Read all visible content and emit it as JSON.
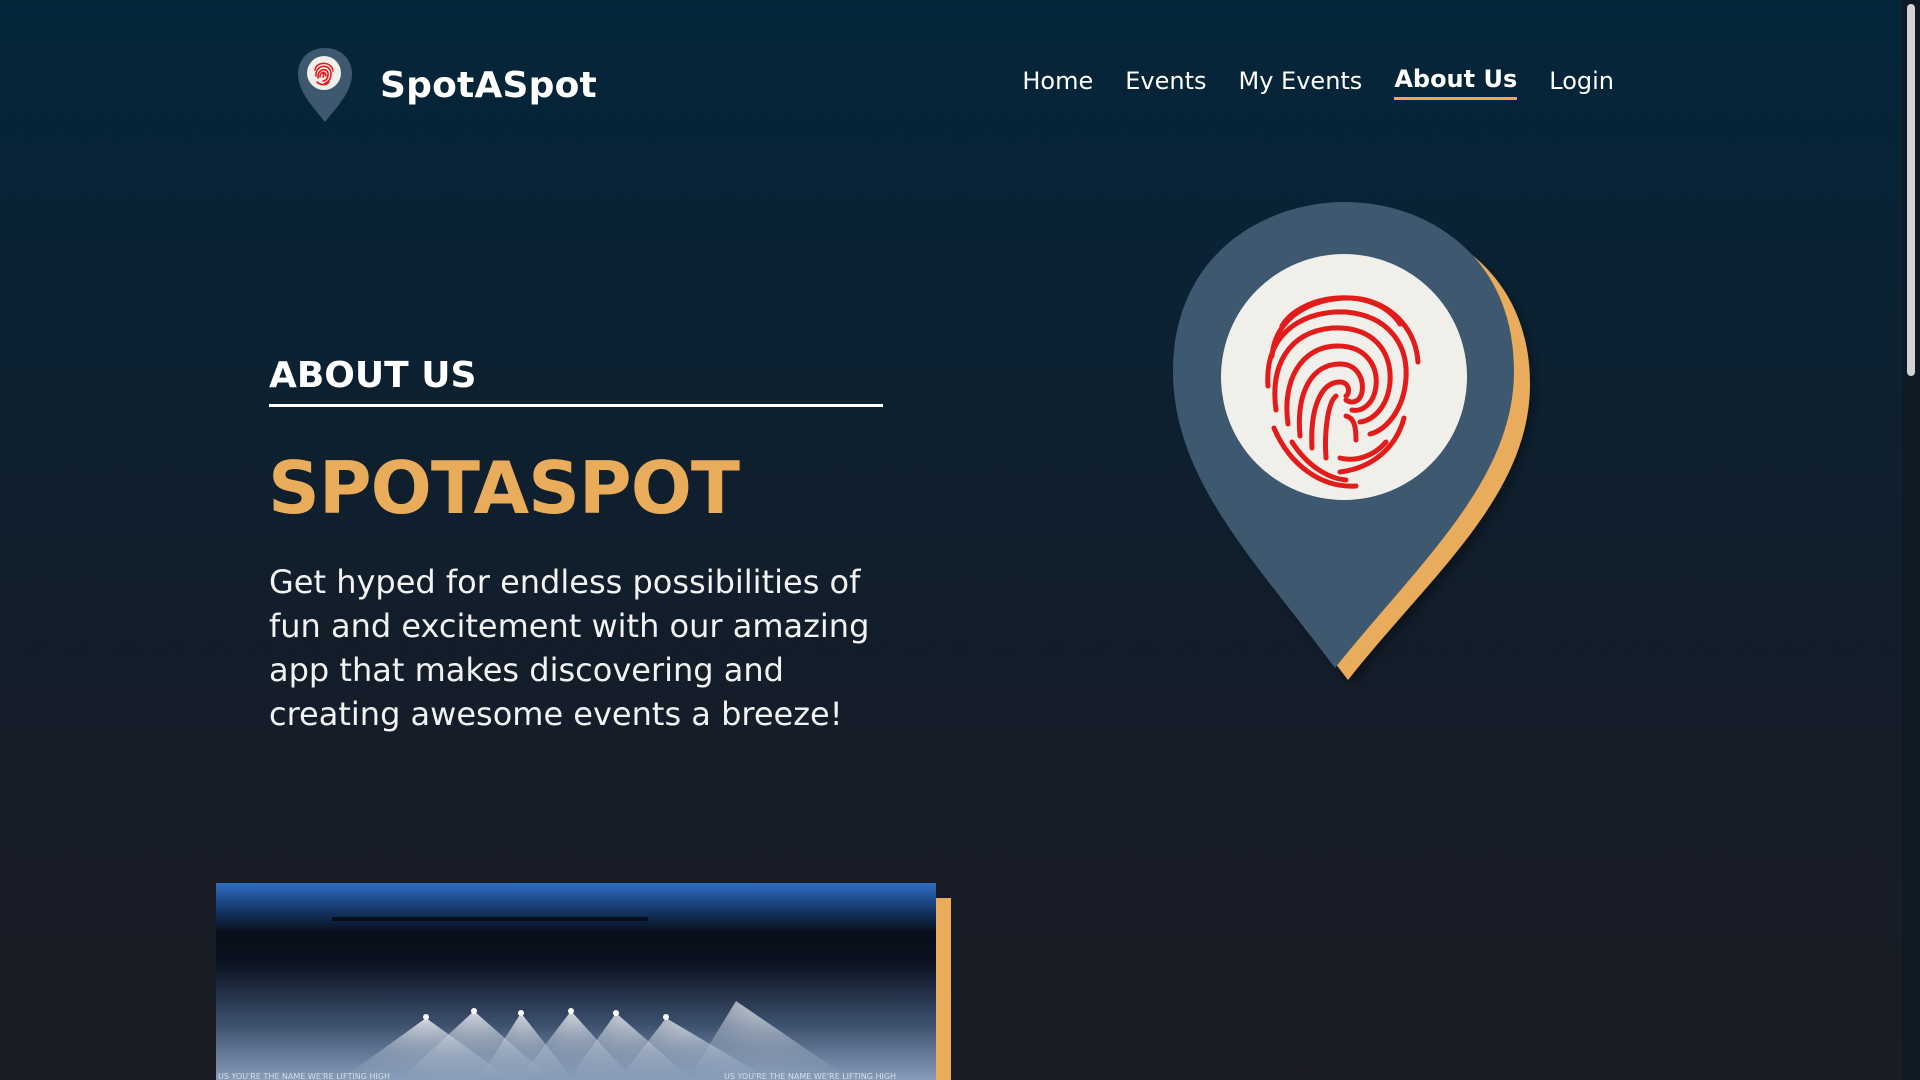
{
  "navbar": {
    "brand_name": "SpotASpot",
    "logo_icon": "map-pin-fingerprint-icon",
    "links": [
      {
        "label": "Home",
        "active": false
      },
      {
        "label": "Events",
        "active": false
      },
      {
        "label": "My Events",
        "active": false
      },
      {
        "label": "About Us",
        "active": true
      },
      {
        "label": "Login",
        "active": false
      }
    ]
  },
  "hero": {
    "section_heading": "ABOUT US",
    "brand_title": "SPOTASPOT",
    "tagline": "Get hyped for endless possibilities of fun and excitement with our amazing app that makes discovering and creating awesome events a breeze!",
    "illustration_icon": "map-pin-fingerprint-icon"
  },
  "colors": {
    "accent": "#e9ac5b",
    "pin_body": "#3e5870",
    "fingerprint": "#e21b1b",
    "background_top": "#04263a",
    "background_bottom": "#1b1c23"
  },
  "concert_image": {
    "banner_text_left": "US YOU'RE THE NAME WE'RE LIFTING HIGH",
    "banner_text_right": "US YOU'RE THE NAME WE'RE LIFTING HIGH"
  }
}
